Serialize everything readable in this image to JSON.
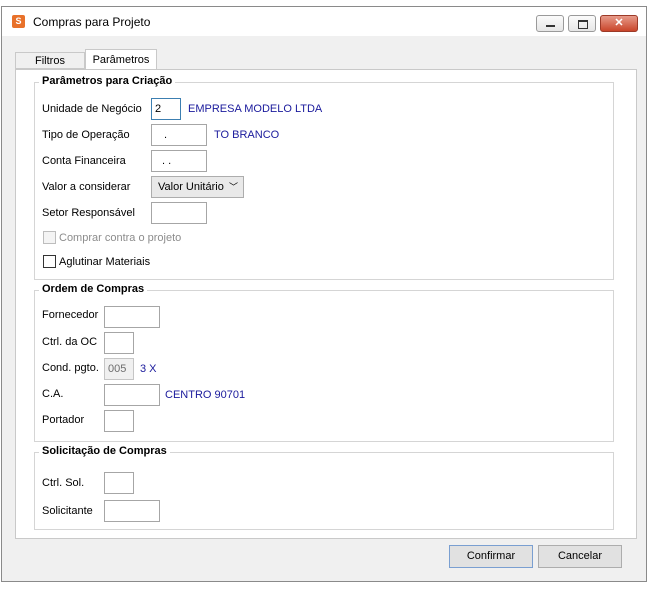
{
  "window": {
    "title": "Compras para Projeto",
    "app_icon": "S"
  },
  "tabs": [
    {
      "label": "Filtros",
      "active": false
    },
    {
      "label": "Parâmetros",
      "active": true
    }
  ],
  "criacao": {
    "title": "Parâmetros para Criação",
    "unidade_label": "Unidade de Negócio",
    "unidade_value": "2",
    "unidade_desc": "EMPRESA MODELO LTDA",
    "tipo_label": "Tipo de Operação",
    "tipo_value": ".",
    "tipo_desc": "TO BRANCO",
    "conta_label": "Conta Financeira",
    "conta_value": ". .",
    "valor_label": "Valor a considerar",
    "valor_value": "Valor Unitário",
    "setor_label": "Setor Responsável",
    "setor_value": "",
    "comprar_label": "Comprar contra o projeto",
    "aglutinar_label": "Aglutinar Materiais"
  },
  "ordem": {
    "title": "Ordem de Compras",
    "fornecedor_label": "Fornecedor",
    "fornecedor_value": "",
    "ctrl_oc_label": "Ctrl. da OC",
    "ctrl_oc_value": "",
    "cond_label": "Cond. pgto.",
    "cond_value": "005",
    "cond_desc": "3 X",
    "ca_label": "C.A.",
    "ca_value": "",
    "ca_desc": "CENTRO 90701",
    "portador_label": "Portador",
    "portador_value": ""
  },
  "solicitacao": {
    "title": "Solicitação de Compras",
    "ctrl_sol_label": "Ctrl. Sol.",
    "ctrl_sol_value": "",
    "solicitante_label": "Solicitante",
    "solicitante_value": ""
  },
  "buttons": {
    "confirm": "Confirmar",
    "cancel": "Cancelar"
  },
  "colors": {
    "accent_desc": "#1a1a9c",
    "close_button": "#c9452a",
    "app_icon": "#e8712a"
  }
}
